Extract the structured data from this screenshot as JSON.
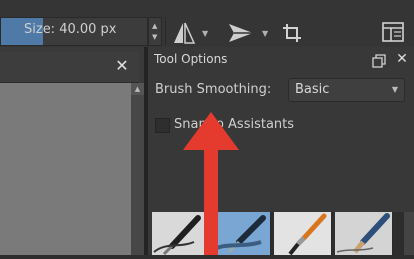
{
  "toolbar": {
    "size_label": "Size: 40.00 px",
    "spin_up": "▲",
    "spin_down": "▼",
    "mirror_caret": "▼",
    "direction_caret": "▼"
  },
  "document": {
    "close_glyph": "✕"
  },
  "docker": {
    "title": "Tool Options",
    "close_glyph": "✕"
  },
  "brush_smoothing": {
    "label": "Brush Smoothing:",
    "value": "Basic",
    "caret": "▼"
  },
  "snap": {
    "label": "Snap to Assistants",
    "checked": false
  },
  "scroll": {
    "up_glyph": "▲"
  },
  "presets": [
    {
      "name": "ink-pen",
      "selected": false
    },
    {
      "name": "blue-fill-pen",
      "selected": true
    },
    {
      "name": "orange-brush",
      "selected": false
    },
    {
      "name": "pencil",
      "selected": false
    }
  ],
  "colors": {
    "accent": "#4f79a6",
    "selected_preset": "#7aa6d4",
    "arrow": "#e53b2f"
  }
}
